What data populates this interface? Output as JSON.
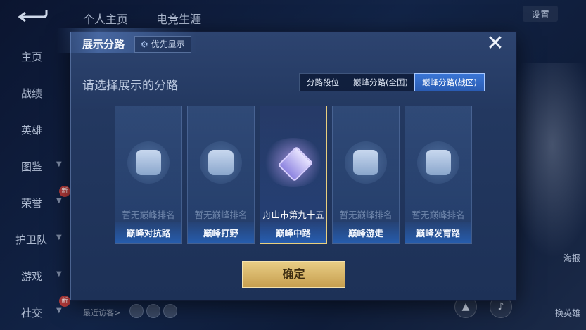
{
  "background": {
    "top_tabs": [
      "个人主页",
      "电竞生涯"
    ],
    "settings_label": "设置",
    "sidebar": [
      {
        "label": "主页"
      },
      {
        "label": "战绩"
      },
      {
        "label": "英雄"
      },
      {
        "label": "图鉴"
      },
      {
        "label": "荣誉",
        "badge": "新"
      },
      {
        "label": "护卫队"
      },
      {
        "label": "游戏"
      },
      {
        "label": "社交",
        "badge": "新"
      }
    ],
    "recent_visitors": "最近访客>",
    "news_label": "海报",
    "swap_hero_label": "换英雄"
  },
  "dialog": {
    "title": "展示分路",
    "priority_label": "优先显示",
    "close_icon": "close-icon",
    "subtitle": "请选择展示的分路",
    "segments": [
      {
        "label": "分路段位",
        "active": false
      },
      {
        "label": "巅峰分路(全国)",
        "active": false
      },
      {
        "label": "巅峰分路(战区)",
        "active": true
      }
    ],
    "cards": [
      {
        "rank": "暂无巅峰排名",
        "lane": "巅峰对抗路",
        "icon": "sword-shield-icon",
        "selected": false
      },
      {
        "rank": "暂无巅峰排名",
        "lane": "巅峰打野",
        "icon": "dragon-icon",
        "selected": false
      },
      {
        "rank": "舟山市第九十五",
        "lane": "巅峰中路",
        "icon": "crystal-icon",
        "selected": true
      },
      {
        "rank": "暂无巅峰排名",
        "lane": "巅峰游走",
        "icon": "wings-icon",
        "selected": false
      },
      {
        "rank": "暂无巅峰排名",
        "lane": "巅峰发育路",
        "icon": "target-icon",
        "selected": false
      }
    ],
    "confirm_label": "确定"
  }
}
